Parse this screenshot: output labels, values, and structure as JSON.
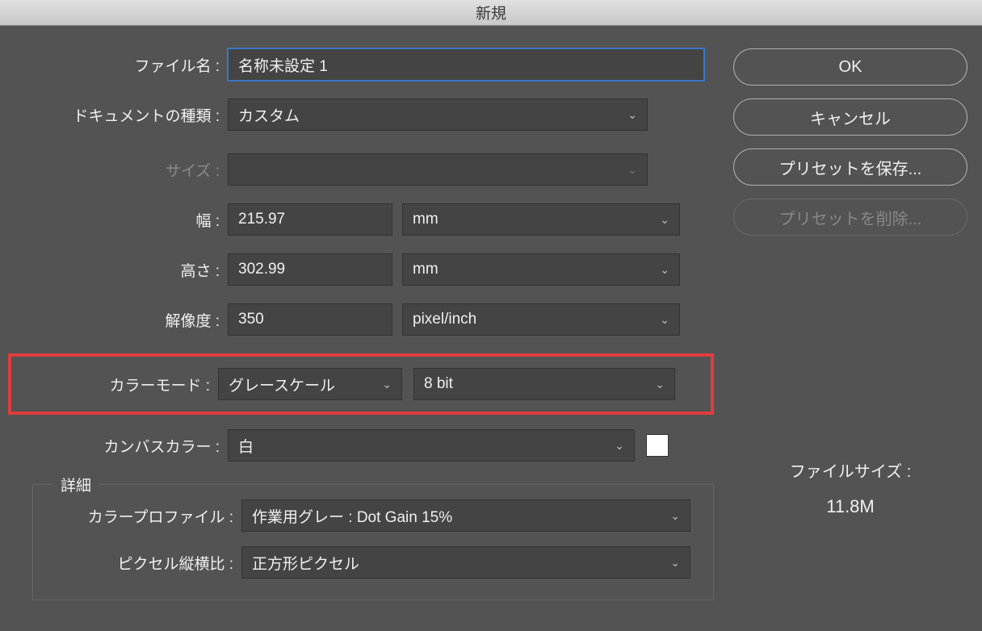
{
  "title": "新規",
  "labels": {
    "filename": "ファイル名 :",
    "docType": "ドキュメントの種類 :",
    "size": "サイズ :",
    "width": "幅 :",
    "height": "高さ :",
    "resolution": "解像度 :",
    "colorMode": "カラーモード :",
    "canvasColor": "カンバスカラー :",
    "advanced": "詳細",
    "colorProfile": "カラープロファイル :",
    "pixelAspect": "ピクセル縦横比 :"
  },
  "values": {
    "filename": "名称未設定 1",
    "docType": "カスタム",
    "sizePreset": "",
    "width": "215.97",
    "widthUnit": "mm",
    "height": "302.99",
    "heightUnit": "mm",
    "resolution": "350",
    "resolutionUnit": "pixel/inch",
    "colorMode": "グレースケール",
    "bitDepth": "8 bit",
    "canvasColor": "白",
    "canvasSwatch": "#ffffff",
    "colorProfile": "作業用グレー : Dot Gain 15%",
    "pixelAspect": "正方形ピクセル"
  },
  "buttons": {
    "ok": "OK",
    "cancel": "キャンセル",
    "savePreset": "プリセットを保存...",
    "deletePreset": "プリセットを削除..."
  },
  "fileSize": {
    "label": "ファイルサイズ :",
    "value": "11.8M"
  }
}
